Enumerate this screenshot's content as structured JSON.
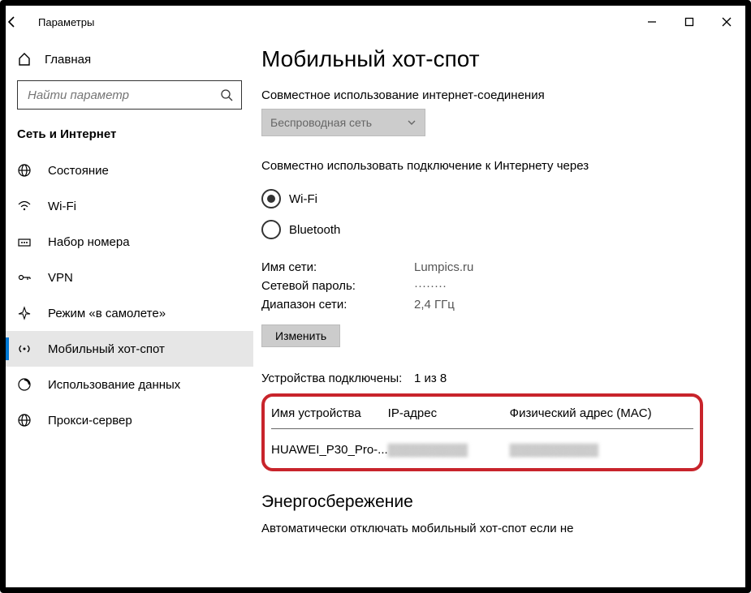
{
  "window": {
    "title": "Параметры"
  },
  "sidebar": {
    "home": "Главная",
    "search_placeholder": "Найти параметр",
    "category": "Сеть и Интернет",
    "items": [
      {
        "label": "Состояние"
      },
      {
        "label": "Wi-Fi"
      },
      {
        "label": "Набор номера"
      },
      {
        "label": "VPN"
      },
      {
        "label": "Режим «в самолете»"
      },
      {
        "label": "Мобильный хот-спот"
      },
      {
        "label": "Использование данных"
      },
      {
        "label": "Прокси-сервер"
      }
    ]
  },
  "main": {
    "title": "Мобильный хот-спот",
    "share_label": "Совместное использование интернет-соединения",
    "share_dropdown": "Беспроводная сеть",
    "share_over_label": "Совместно использовать подключение к Интернету через",
    "radio_wifi": "Wi-Fi",
    "radio_bt": "Bluetooth",
    "info": {
      "net_name_label": "Имя сети:",
      "net_name_value": "Lumpics.ru",
      "net_pass_label": "Сетевой пароль:",
      "net_pass_value": "········",
      "band_label": "Диапазон сети:",
      "band_value": "2,4 ГГц"
    },
    "edit_button": "Изменить",
    "devices": {
      "label": "Устройства подключены:",
      "count": "1 из 8",
      "col_name": "Имя устройства",
      "col_ip": "IP-адрес",
      "col_mac": "Физический адрес (MAC)",
      "row": {
        "name": "HUAWEI_P30_Pro-...",
        "ip": "▓▓▓▓▓▓▓▓▓",
        "mac": "▓▓▓▓▓▓▓▓▓▓"
      }
    },
    "power_title": "Энергосбережение",
    "power_text": "Автоматически отключать мобильный хот-спот если не"
  }
}
